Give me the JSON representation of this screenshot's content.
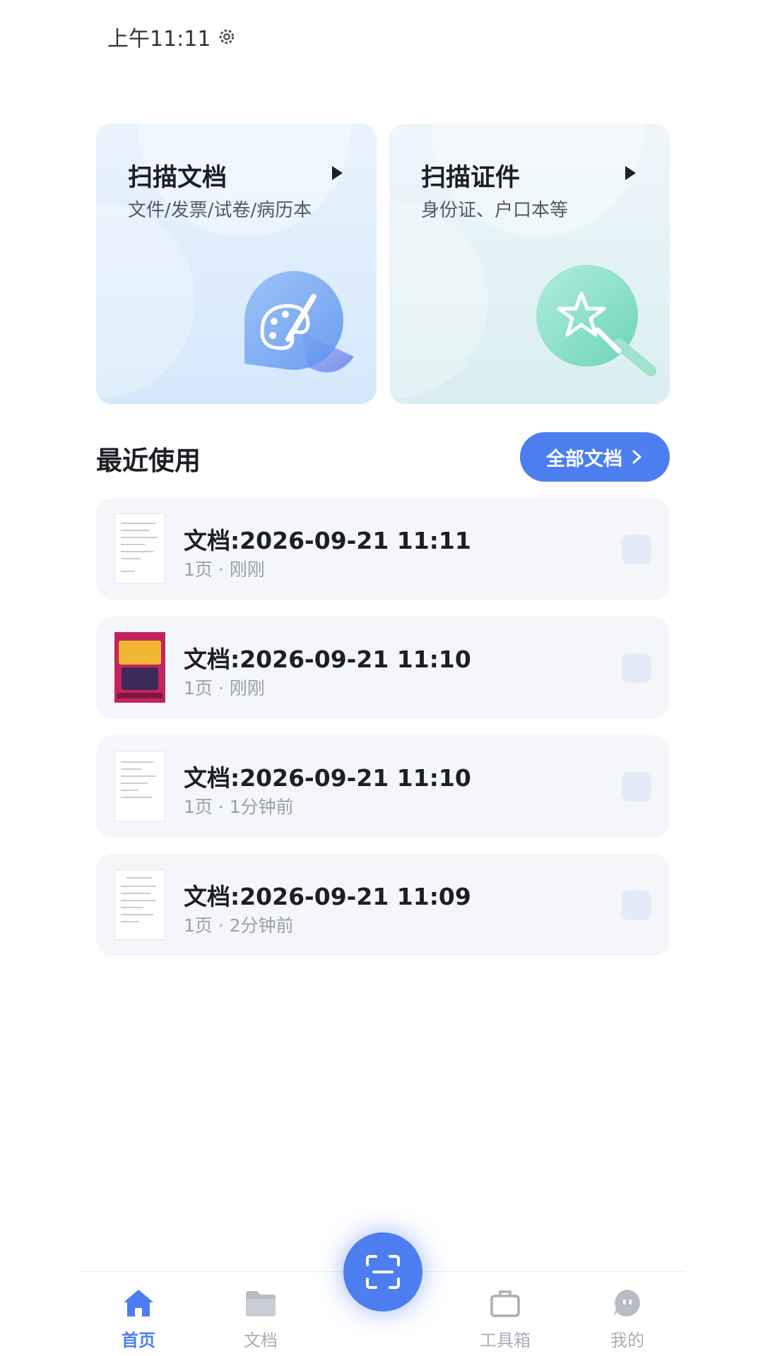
{
  "status_bar": {
    "time": "上午11:11"
  },
  "cards": [
    {
      "title": "扫描文档",
      "subtitle": "文件/发票/试卷/病历本",
      "icon": "palette-icon"
    },
    {
      "title": "扫描证件",
      "subtitle": "身份证、户口本等",
      "icon": "magic-wand-icon"
    }
  ],
  "recent": {
    "title": "最近使用",
    "all_docs_label": "全部文档",
    "items": [
      {
        "title": "文档:2026-09-21 11:11",
        "pages": "1页",
        "sep": "·",
        "time": "刚刚"
      },
      {
        "title": "文档:2026-09-21 11:10",
        "pages": "1页",
        "sep": "·",
        "time": "刚刚"
      },
      {
        "title": "文档:2026-09-21 11:10",
        "pages": "1页",
        "sep": "·",
        "time": "1分钟前"
      },
      {
        "title": "文档:2026-09-21 11:09",
        "pages": "1页",
        "sep": "·",
        "time": "2分钟前"
      }
    ]
  },
  "nav": {
    "home": "首页",
    "docs": "文档",
    "tools": "工具箱",
    "me": "我的"
  },
  "colors": {
    "accent": "#4d7ef0",
    "card_bg": "#f4f6f9",
    "text_primary": "#1c1f26",
    "text_secondary": "#9aa0a9"
  }
}
